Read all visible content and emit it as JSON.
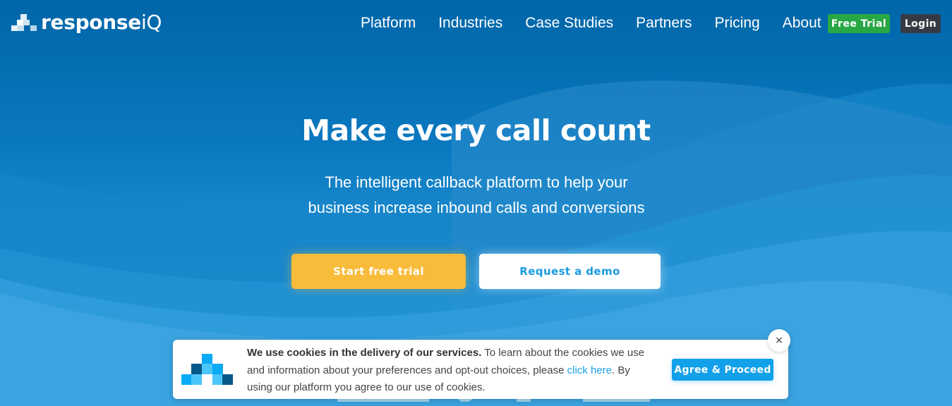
{
  "brand": {
    "name": "response",
    "name_suffix": "iQ",
    "colors": {
      "primary_dark": "#0066a8",
      "primary_light": "#3aa4e0",
      "accent_yellow": "#f8bb3a",
      "green": "#28a745",
      "dark": "#363a45",
      "link_blue": "#1aa3e8"
    }
  },
  "nav": {
    "items": [
      {
        "label": "Platform"
      },
      {
        "label": "Industries"
      },
      {
        "label": "Case Studies"
      },
      {
        "label": "Partners"
      },
      {
        "label": "Pricing"
      },
      {
        "label": "About"
      }
    ],
    "free_trial_label": "Free Trial",
    "login_label": "Login"
  },
  "hero": {
    "title": "Make every call count",
    "subtitle": "The intelligent callback platform to help your business increase inbound calls and conversions",
    "primary_cta": "Start free trial",
    "secondary_cta": "Request a demo"
  },
  "cookie_banner": {
    "bold_text": "We use cookies in the delivery of our services.",
    "text_before_link": " To learn about the cookies we use and information about your preferences and opt-out choices, please ",
    "link_text": "click here",
    "text_after_link": ". By using our platform you agree to our use of cookies.",
    "agree_label": "Agree & Proceed",
    "close_icon": "×"
  }
}
